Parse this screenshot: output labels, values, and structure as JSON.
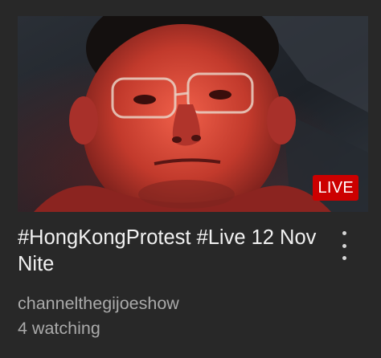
{
  "video": {
    "title": "#HongKongProtest #Live 12 Nov Nite",
    "channel": "channelthegijoeshow",
    "watching": "4 watching",
    "badge": "LIVE"
  },
  "icons": {
    "menu": "more-vertical-icon"
  },
  "colors": {
    "background": "#282828",
    "title": "#f1f1f1",
    "meta": "#aaaaaa",
    "live_badge": "#cc0000"
  }
}
